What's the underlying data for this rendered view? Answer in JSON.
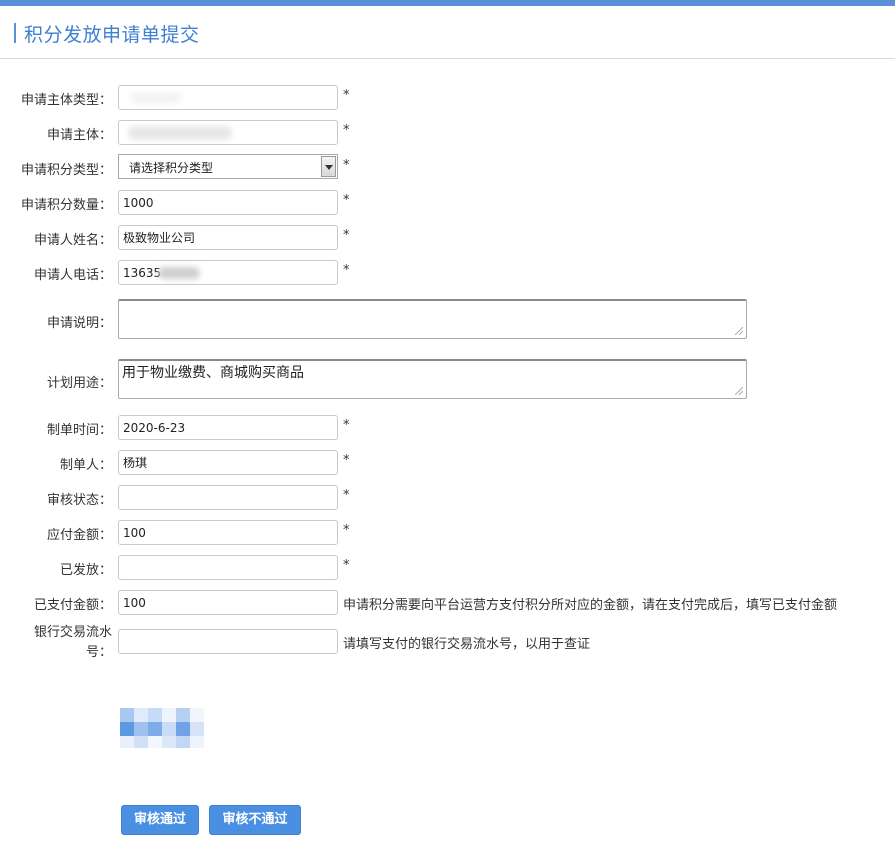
{
  "header": {
    "title": "积分发放申请单提交"
  },
  "form": {
    "applicant_type": {
      "label": "申请主体类型：",
      "value": "",
      "required": "*"
    },
    "applicant": {
      "label": "申请主体：",
      "value": "",
      "required": "*"
    },
    "points_type": {
      "label": "申请积分类型：",
      "value": "请选择积分类型",
      "required": "*"
    },
    "points_amount": {
      "label": "申请积分数量：",
      "value": "1000",
      "required": "*"
    },
    "applicant_name": {
      "label": "申请人姓名：",
      "value": "极致物业公司",
      "required": "*"
    },
    "applicant_phone": {
      "label": "申请人电话：",
      "value": "13635",
      "required": "*"
    },
    "description": {
      "label": "申请说明：",
      "value": ""
    },
    "purpose": {
      "label": "计划用途：",
      "value": "用于物业缴费、商城购买商品"
    },
    "created_time": {
      "label": "制单时间：",
      "value": "2020-6-23",
      "required": "*"
    },
    "creator": {
      "label": "制单人：",
      "value": "杨琪",
      "required": "*"
    },
    "review_status": {
      "label": "审核状态：",
      "value": "",
      "required": "*"
    },
    "payable_amount": {
      "label": "应付金额：",
      "value": "100",
      "required": "*"
    },
    "issued": {
      "label": "已发放：",
      "value": "",
      "required": "*"
    },
    "paid_amount": {
      "label": "已支付金额：",
      "value": "100",
      "hint": "申请积分需要向平台运营方支付积分所对应的金额，请在支付完成后，填写已支付金额"
    },
    "bank_serial": {
      "label": "银行交易流水号：",
      "value": "",
      "hint": "请填写支付的银行交易流水号，以用于查证"
    }
  },
  "actions": {
    "approve": "审核通过",
    "reject": "审核不通过"
  },
  "colors": {
    "accent": "#4a90e2",
    "title": "#3f7fd3",
    "top_bar": "#5b8fd8"
  }
}
